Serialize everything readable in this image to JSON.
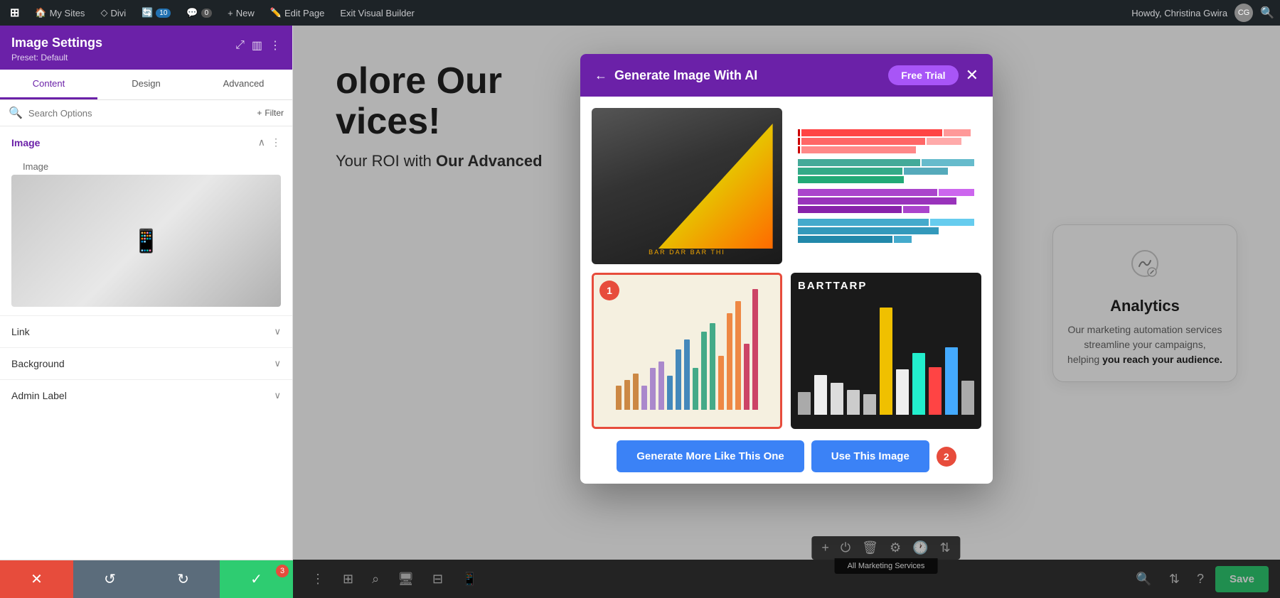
{
  "adminBar": {
    "wpIcon": "W",
    "mySites": "My Sites",
    "divi": "Divi",
    "updates": "10",
    "comments": "0",
    "new": "New",
    "editPage": "Edit Page",
    "exitBuilder": "Exit Visual Builder",
    "user": "Howdy, Christina Gwira",
    "searchIcon": "🔍"
  },
  "sidebar": {
    "title": "Image Settings",
    "preset": "Preset: Default",
    "tabs": [
      "Content",
      "Design",
      "Advanced"
    ],
    "activeTab": "Content",
    "searchPlaceholder": "Search Options",
    "filterLabel": "Filter",
    "sections": {
      "image": {
        "title": "Image",
        "imageLabel": "Image"
      },
      "link": {
        "title": "Link"
      },
      "background": {
        "title": "Background"
      },
      "adminLabel": {
        "title": "Admin Label"
      }
    },
    "bottomButtons": {
      "cancel": "✕",
      "undo": "↺",
      "redo": "↻",
      "save": "✓",
      "saveBadge": "3"
    }
  },
  "modal": {
    "title": "Generate Image With AI",
    "backIcon": "←",
    "freeTrial": "Free Trial",
    "closeIcon": "✕",
    "images": [
      {
        "id": 1,
        "label": "bar chart diagonal",
        "selected": false
      },
      {
        "id": 2,
        "label": "colorful horizontal bars",
        "selected": false
      },
      {
        "id": 3,
        "label": "vertical bar chart beige",
        "selected": true,
        "selectionNumber": "1"
      },
      {
        "id": 4,
        "label": "dark bar chart colorful",
        "selected": false
      }
    ],
    "generateBtn": "Generate More Like This One",
    "useBtn": "Use This Image",
    "useBtnBadge": "2"
  },
  "pageContent": {
    "heading": "olore Our",
    "heading2": "vices!",
    "subtext1": "Your ROI with",
    "subtext2": "Our Advanced",
    "analyticsCard": {
      "title": "Analytics",
      "description": "Our marketing automation services streamline your campaigns, helping",
      "descriptionBold": "you reach your audience."
    }
  },
  "vbToolbar": {
    "saveBtn": "Save",
    "allMarketingServices": "All Marketing Services"
  }
}
